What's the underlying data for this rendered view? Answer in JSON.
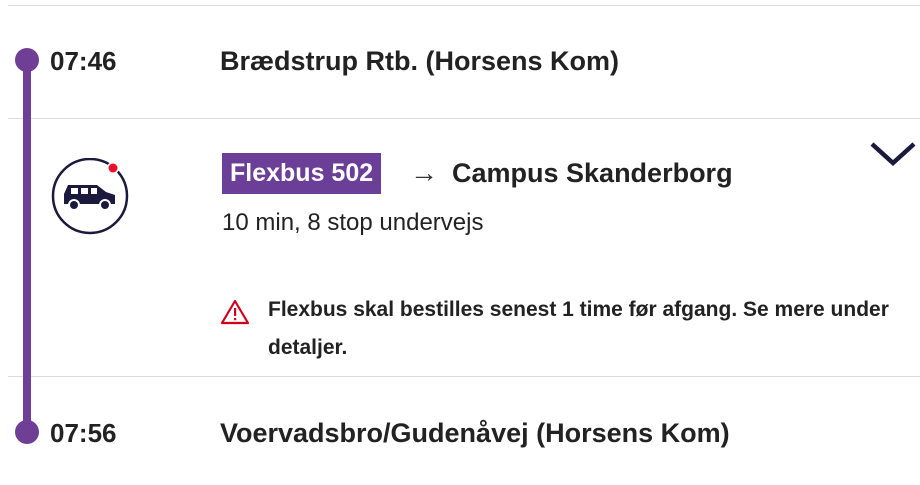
{
  "stops": [
    {
      "time": "07:46",
      "name": "Brædstrup Rtb. (Horsens Kom)"
    },
    {
      "time": "07:56",
      "name": "Voervadsbro/Gudenåvej (Horsens Kom)"
    }
  ],
  "leg": {
    "mode_icon": "bus-icon",
    "line": "Flexbus 502",
    "arrow": "→",
    "destination": "Campus Skanderborg",
    "duration": "10 min, 8 stop undervejs",
    "warning": "Flexbus skal bestilles senest 1 time før afgang. Se mere under detaljer.",
    "expand_icon": "chevron-down-icon",
    "warning_icon": "warning-triangle-icon"
  },
  "colors": {
    "route": "#6f3f96",
    "badge": "#6b3e98",
    "warning": "#d0021b",
    "indicator": "#e8102a"
  }
}
